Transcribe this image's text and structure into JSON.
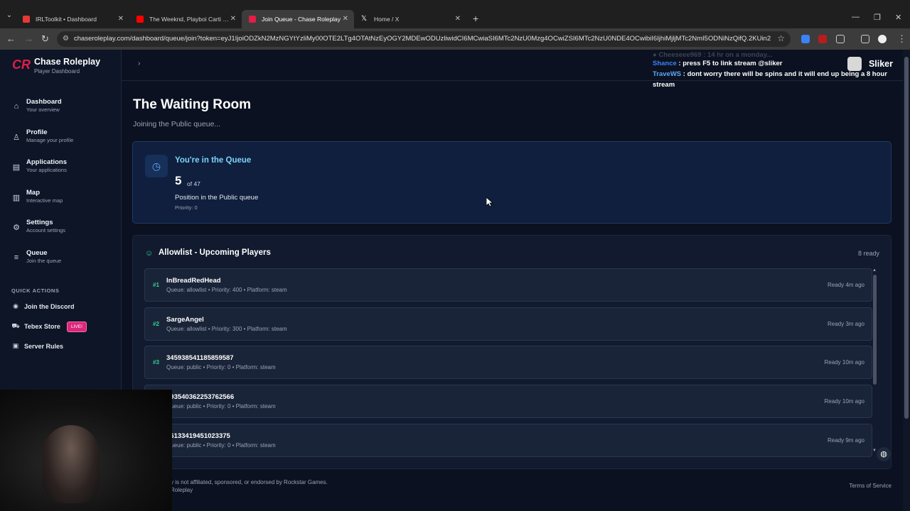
{
  "browser": {
    "tabs": [
      {
        "title": "IRLToolkit • Dashboard",
        "color": "#e53935",
        "active": false
      },
      {
        "title": "The Weeknd, Playboi Carti - Tim",
        "color": "#ff0000",
        "active": false
      },
      {
        "title": "Join Queue - Chase Roleplay",
        "color": "#e11d48",
        "active": true
      },
      {
        "title": "Home / X",
        "color": "#ffffff",
        "active": false
      }
    ],
    "url": "chaseroleplay.com/dashboard/queue/join?token=eyJ1IjoiODZkN2MzNGYtYzliMy00OTE2LTg4OTAtNzEyOGY2MDEwODUzliwidCI6MCwiaSI6MTc2NzU0Mzg4OCwiZSI6MTc2NzU0NDE4OCwibiI6IjhiMjljMTc2NmI5ODNiNzQifQ.2KUin2N3pTbL..."
  },
  "brand": {
    "name": "Chase Roleplay",
    "subtitle": "Player Dashboard"
  },
  "nav": [
    {
      "label": "Dashboard",
      "sub": "Your overview",
      "icon": "home-icon"
    },
    {
      "label": "Profile",
      "sub": "Manage your profile",
      "icon": "user-icon"
    },
    {
      "label": "Applications",
      "sub": "Your applications",
      "icon": "document-icon"
    },
    {
      "label": "Map",
      "sub": "Interactive map",
      "icon": "map-icon"
    },
    {
      "label": "Settings",
      "sub": "Account settings",
      "icon": "gear-icon"
    },
    {
      "label": "Queue",
      "sub": "Join the queue",
      "icon": "list-icon"
    }
  ],
  "quick_actions": {
    "title": "QUICK ACTIONS",
    "items": [
      {
        "label": "Join the Discord",
        "icon": "discord-icon"
      },
      {
        "label": "Tebex Store",
        "icon": "cart-icon",
        "badge": "LIVE!"
      },
      {
        "label": "Server Rules",
        "icon": "rules-icon"
      }
    ]
  },
  "user": {
    "name": "Sliker"
  },
  "chat": {
    "faded": "● Cheeseee969 : 14 hr on a monday...",
    "lines": [
      {
        "name": "Shance",
        "msg": " : press F5 to link stream @sliker"
      },
      {
        "name": "TraveWS",
        "msg": " : dont worry there will be spins and it will end up being a 8 hour stream"
      }
    ]
  },
  "page": {
    "title": "The Waiting Room",
    "subtitle": "Joining the Public queue..."
  },
  "queue": {
    "title": "You're in the Queue",
    "position": "5",
    "of": "of 47",
    "label": "Position in the Public queue",
    "priority": "Priority: 0"
  },
  "allowlist": {
    "title": "Allowlist - Upcoming Players",
    "ready_count": "8 ready",
    "players": [
      {
        "rank": "#1",
        "name": "InBreadRedHead",
        "meta": "Queue: allowlist • Priority: 400 • Platform: steam",
        "time": "Ready 4m ago"
      },
      {
        "rank": "#2",
        "name": "SargeAngel",
        "meta": "Queue: allowlist • Priority: 300 • Platform: steam",
        "time": "Ready 3m ago"
      },
      {
        "rank": "#3",
        "name": "345938541185859587",
        "meta": "Queue: public • Priority: 0 • Platform: steam",
        "time": "Ready 10m ago"
      },
      {
        "rank": "",
        "name": "093540362253762566",
        "meta": "Queue: public • Priority: 0 • Platform: steam",
        "time": "Ready 10m ago"
      },
      {
        "rank": "",
        "name": "76133419451023375",
        "meta": "Queue: public • Priority: 0 • Platform: steam",
        "time": "Ready 9m ago"
      }
    ]
  },
  "footer": {
    "disclaimer": "y is not affiliated, sponsored, or endorsed by Rockstar Games.",
    "copyright": "Roleplay",
    "terms": "Terms of Service"
  },
  "colors": {
    "accent": "#e11d48",
    "queue_title": "#7dd3fc",
    "rank_green": "#34d399"
  }
}
